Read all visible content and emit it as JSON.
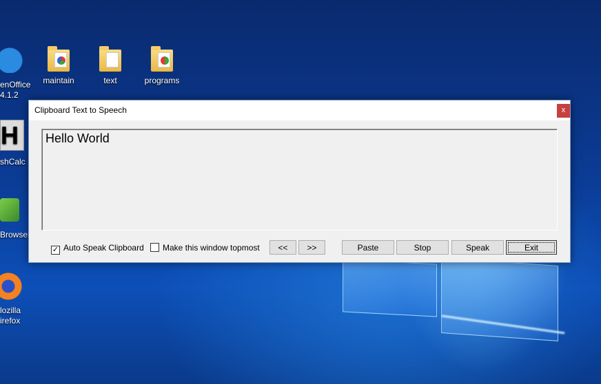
{
  "desktop": {
    "icons": [
      {
        "label": "maintain"
      },
      {
        "label": "text"
      },
      {
        "label": "programs"
      }
    ],
    "left_icons": [
      {
        "line1": "enOffice",
        "line2": "4.1.2"
      },
      {
        "line1": "shCalc"
      },
      {
        "line1": "Browser"
      },
      {
        "line1": "lozilla",
        "line2": "irefox"
      }
    ],
    "calc_glyph": "H"
  },
  "dialog": {
    "title": "Clipboard Text to Speech",
    "close_label": "x",
    "text": "Hello World",
    "auto_speak": {
      "label": "Auto Speak Clipboard",
      "checked": true,
      "check_glyph": "✓"
    },
    "topmost": {
      "label": "Make this window topmost",
      "checked": false
    },
    "buttons": {
      "prev": "<<",
      "next": ">>",
      "paste": "Paste",
      "stop": "Stop",
      "speak": "Speak",
      "exit": "Exit"
    }
  },
  "colors": {
    "close_button": "#c74040",
    "dialog_bg": "#f0f0f0"
  }
}
